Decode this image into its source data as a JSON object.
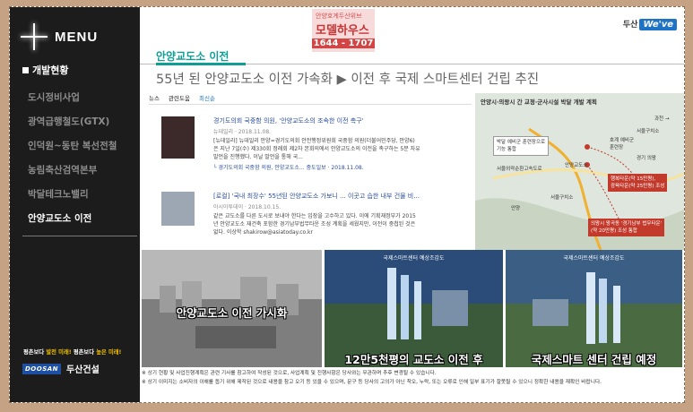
{
  "sidebar": {
    "menu_title": "MENU",
    "section_title": "개발현황",
    "items": [
      {
        "label": "도시정비사업"
      },
      {
        "label": "광역급행철도(GTX)"
      },
      {
        "label": "인덕원~동탄 복선전철"
      },
      {
        "label": "농림축산검역본부"
      },
      {
        "label": "박달테크노밸리"
      },
      {
        "label": "안양교도소 이전"
      }
    ],
    "slogan_1": "평촌보다 ",
    "slogan_2": "발전 미래!",
    "slogan_3": " 평촌보다 ",
    "slogan_4": "높은 미래!",
    "brand_logo": "DOOSAN",
    "brand_name": "두산건설"
  },
  "ad": {
    "line1": "안양호계두산위브",
    "line2": "모델하우스",
    "phone": "1644 - 1707"
  },
  "logo": {
    "prefix": "두산",
    "mark": "We've"
  },
  "page": {
    "title": "안양교도소 이전",
    "headline": "55년 된 안양교도소 이전 가속화 ▶ 이전 후 국제 스마트센터 건립 추진"
  },
  "news": {
    "tabs": [
      "뉴스",
      "관련도움",
      "최신순"
    ],
    "articles": [
      {
        "title": "경기도의회 국중함 의원, '안양교도소의 조속한 이전 촉구'",
        "meta": "뉴데일리 · 2018.11.08.",
        "body1": "[뉴데일리] 뉴데일리 안양=경기도의회 안전행정위원회 국중함 의원(더불어민주당, 안양6)",
        "body2": "은 지난 7일(수) 제330회 정례회 제2차 본회의에서 안양교도소의 이전을 촉구하는 5분 자유",
        "body3": "발언을 진행했다. 이날 발언을 통해 국...",
        "sub": "└ 경기도의회 국중함 의원, 안양교도소...   중도일보 · 2018.11.08."
      },
      {
        "title": "[로컬] '국내 최장수' 55년된 안양교도소 가보니 ... 이곳고 습한 내부 건물 비...",
        "meta": "아시아투데이 · 2018.10.15.",
        "body1": "같은 교도소를 다른 도시로 보내야 한다는 입장을 고수하고 있다. 이에 기획재정부가 2015",
        "body2": "년 안양교도소 재건축 포함한 경기남부법무타운 조성 계획을 세웠지만, 이전이 중첩된 것은",
        "body3": "없다. 이상학 shakirow@asiatoday.co.kr"
      }
    ]
  },
  "map": {
    "title": "안양시·의왕시 간 교정·군사시설 박달 개발 계획",
    "labels": [
      "박달 예비군 훈련장으로",
      "기능 통합",
      "과천 →",
      "서울구치소",
      "호계 예비군",
      "훈련장",
      "경기 의왕",
      "서울외곽순환고속도로",
      "안양교도소",
      "행복타운(약 15만평),",
      "광육타운(약 25만평) 조성",
      "의왕시 왕곡동 '경기남부 법무타운'",
      "(약 20만평) 조성 통합",
      "안양",
      "서울구치소"
    ]
  },
  "banners": [
    {
      "caption": "안양교도소 이전 가시화",
      "tag": ""
    },
    {
      "caption": "12만5천평의 교도소 이전 후",
      "tag": "국제스마트센터 예상조감도"
    },
    {
      "caption": "국제스마트 센터 건립 예정",
      "tag": "국제스마트센터 예상조감도"
    }
  ],
  "notes": {
    "line1": "※ 상기 현황 및 사업진행계획은 관련 기사를 참고하여 작성된 것으로, 사업계획 및 진행사항은 당사와는 무관하며 추후 변경될 수 있습니다.",
    "line2": "※ 상기 이미지는 소비자의 이해를 돕기 위해 제작된 것으로 내용을 참고 오기 등 있을 수 있으며, 문구 등 당사의 고의가 아닌 착오, 누락, 또는 오류로 인해 일부 표기가 잘못될 수 있으니 정확한 내용을 재확인 바랍니다."
  },
  "colors": {
    "accent": "#0f9e96",
    "sidebar_bg": "#1c1c1c",
    "frame": "#c4a283"
  }
}
